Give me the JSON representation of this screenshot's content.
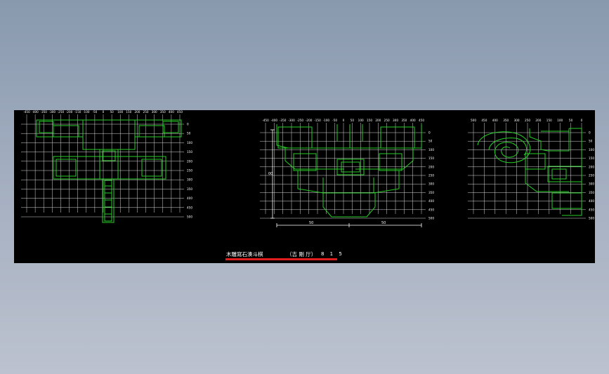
{
  "drawing": {
    "caption_main": "木雕寫石湊斗棋",
    "caption_sub": "（吉 剛 厅）",
    "caption_number": "8 1 5",
    "underline_color": "#e01c1c",
    "line_color": "#28d028",
    "grid_color": "#d8d8d8",
    "background_color": "#000000"
  },
  "view1": {
    "x_ticks": [
      "-450",
      "-400",
      "-350",
      "-300",
      "-250",
      "-200",
      "-150",
      "-100",
      "-50",
      "0",
      "50",
      "100",
      "150",
      "200",
      "250",
      "300",
      "350",
      "400",
      "450"
    ],
    "y_ticks": [
      "0",
      "50",
      "100",
      "150",
      "200",
      "250",
      "300",
      "350",
      "400",
      "450",
      "500"
    ]
  },
  "view2": {
    "x_ticks": [
      "-450",
      "-400",
      "-350",
      "-300",
      "-250",
      "-200",
      "-150",
      "-100",
      "-50",
      "0",
      "50",
      "100",
      "150",
      "200",
      "250",
      "300",
      "350",
      "400",
      "450"
    ],
    "y_ticks": [
      "0",
      "50",
      "100",
      "150",
      "200",
      "250",
      "300",
      "350",
      "400",
      "450",
      "500"
    ],
    "dimension_label_left": "50",
    "dimension_label_right": "50",
    "height_label": "00"
  },
  "view3": {
    "x_ticks": [
      "500",
      "450",
      "400",
      "350",
      "300",
      "250",
      "200",
      "150",
      "100",
      "50",
      "0"
    ],
    "y_ticks": [
      "0",
      "50",
      "100",
      "150",
      "200",
      "250",
      "300",
      "350",
      "400",
      "450",
      "500"
    ]
  }
}
